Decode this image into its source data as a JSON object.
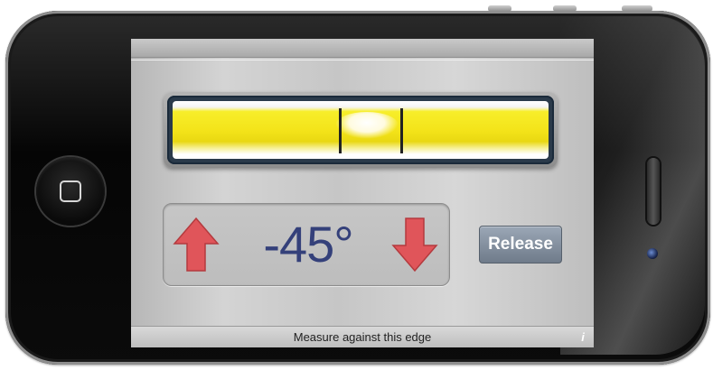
{
  "level": {
    "angle": "-45°",
    "release_label": "Release",
    "edge_hint": "Measure against this edge",
    "info_glyph": "i"
  },
  "icons": {
    "up_arrow": "arrow-up-icon",
    "down_arrow": "arrow-down-icon",
    "info": "info-icon"
  },
  "colors": {
    "angle_text": "#34407a",
    "arrow": "#e0555a",
    "vial_liquid": "#f4e41a",
    "release_button": "#8a96a5"
  }
}
